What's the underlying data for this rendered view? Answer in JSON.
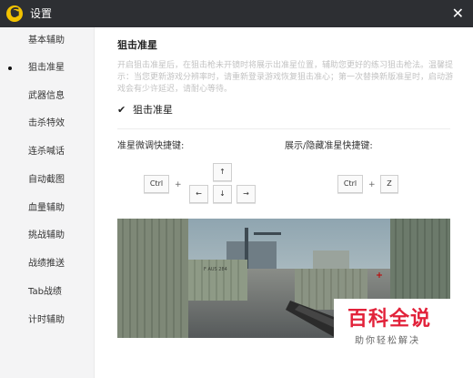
{
  "window": {
    "logo_letter": "G",
    "title": "设置",
    "close_glyph": "✕"
  },
  "sidebar": {
    "items": [
      {
        "label": "基本辅助",
        "active": false
      },
      {
        "label": "狙击准星",
        "active": true
      },
      {
        "label": "武器信息",
        "active": false
      },
      {
        "label": "击杀特效",
        "active": false
      },
      {
        "label": "连杀喊话",
        "active": false
      },
      {
        "label": "自动截图",
        "active": false
      },
      {
        "label": "血量辅助",
        "active": false
      },
      {
        "label": "挑战辅助",
        "active": false
      },
      {
        "label": "战绩推送",
        "active": false
      },
      {
        "label": "Tab战绩",
        "active": false
      },
      {
        "label": "计时辅助",
        "active": false
      }
    ]
  },
  "content": {
    "section_title": "狙击准星",
    "description": "开启狙击准星后，在狙击枪未开镜时将展示出准星位置，辅助您更好的练习狙击枪法。温馨提示：当您更新游戏分辨率时，请重新登录游戏恢复狙击准心；第一次替换新版准星时，启动游戏会有少许延迟，请耐心等待。",
    "checkbox": {
      "label": "狙击准星",
      "checked": true,
      "check_glyph": "✔"
    },
    "fine_tune": {
      "label": "准星微调快捷键:",
      "modifier_key": "Ctrl",
      "plus": "+",
      "arrow_up": "↑",
      "arrow_left": "←",
      "arrow_down": "↓",
      "arrow_right": "→"
    },
    "toggle": {
      "label": "展示/隐藏准星快捷键:",
      "modifier_key": "Ctrl",
      "plus": "+",
      "key": "Z"
    }
  },
  "preview": {
    "overlay_text": "F AUS 284"
  },
  "watermark": {
    "main": "百科全说",
    "sub": "助你轻松解决"
  },
  "colors": {
    "titlebar": "#2d2f33",
    "logo": "#f2c200",
    "sidebar_bg": "#f4f4f5",
    "description_text": "#c3c3c3",
    "watermark_red": "#e2223a"
  }
}
